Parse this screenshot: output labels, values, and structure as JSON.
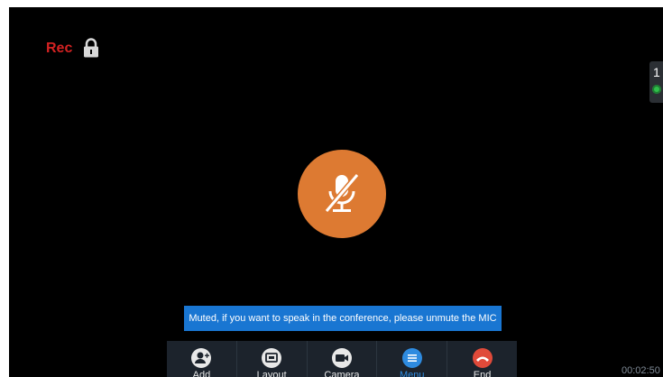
{
  "call": {
    "recording_label": "Rec",
    "participant_count": "1",
    "duration": "00:02:50",
    "muted_notice": "Muted, if you want to speak in the conference, please unmute the MIC"
  },
  "toolbar": {
    "add_label": "Add",
    "layout_label": "Layout",
    "camera_label": "Camera",
    "menu_label": "Menu",
    "end_label": "End"
  },
  "icons": {
    "lock": "lock-icon",
    "mute": "mic-muted-icon",
    "add": "add-user-icon",
    "layout": "layout-icon",
    "camera": "camera-icon",
    "menu": "menu-icon",
    "end": "end-call-icon"
  },
  "colors": {
    "recording": "#d42222",
    "mute_circle": "#dd7a32",
    "toast_bg": "#1976d2",
    "active_tool": "#2e8be0",
    "end_call": "#e04a3a",
    "status_online": "#2fbf4a"
  }
}
